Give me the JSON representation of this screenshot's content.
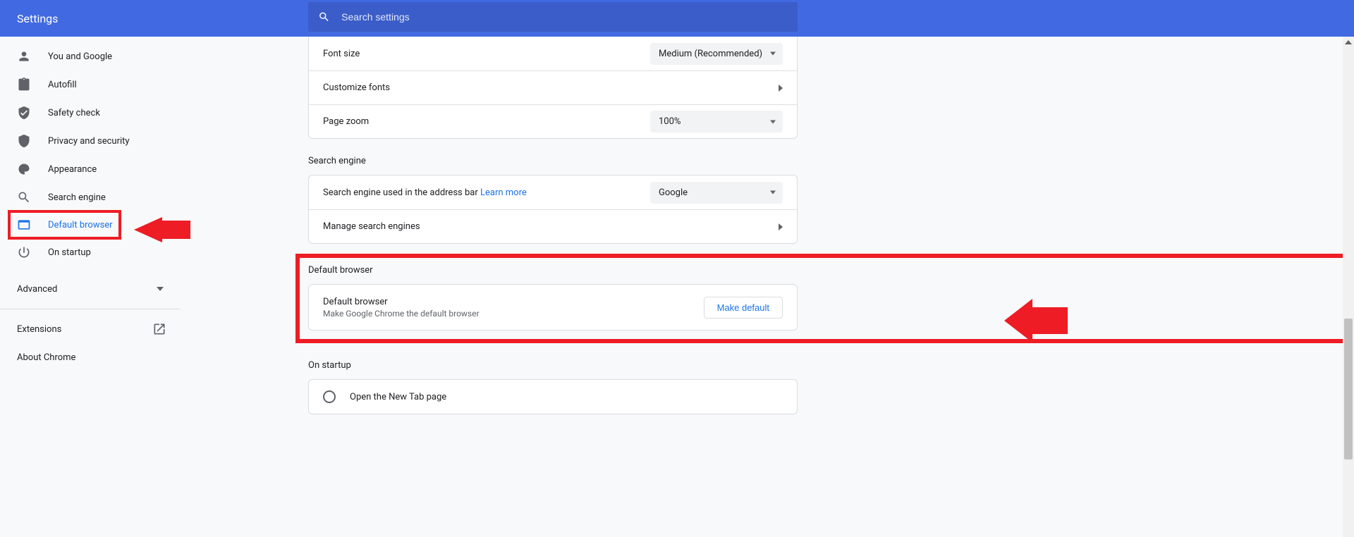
{
  "header": {
    "title": "Settings",
    "search_placeholder": "Search settings"
  },
  "sidebar": {
    "items": [
      {
        "label": "You and Google"
      },
      {
        "label": "Autofill"
      },
      {
        "label": "Safety check"
      },
      {
        "label": "Privacy and security"
      },
      {
        "label": "Appearance"
      },
      {
        "label": "Search engine"
      },
      {
        "label": "Default browser"
      },
      {
        "label": "On startup"
      }
    ],
    "advanced": "Advanced",
    "extensions": "Extensions",
    "about": "About Chrome"
  },
  "rows": {
    "font_size": {
      "label": "Font size",
      "value": "Medium (Recommended)"
    },
    "customize_fonts": "Customize fonts",
    "page_zoom": {
      "label": "Page zoom",
      "value": "100%"
    }
  },
  "search_engine": {
    "title": "Search engine",
    "used_label": "Search engine used in the address bar",
    "learn_more": "Learn more",
    "value": "Google",
    "manage": "Manage search engines"
  },
  "default_browser": {
    "title": "Default browser",
    "label": "Default browser",
    "sub": "Make Google Chrome the default browser",
    "button": "Make default"
  },
  "on_startup": {
    "title": "On startup",
    "option1": "Open the New Tab page"
  }
}
